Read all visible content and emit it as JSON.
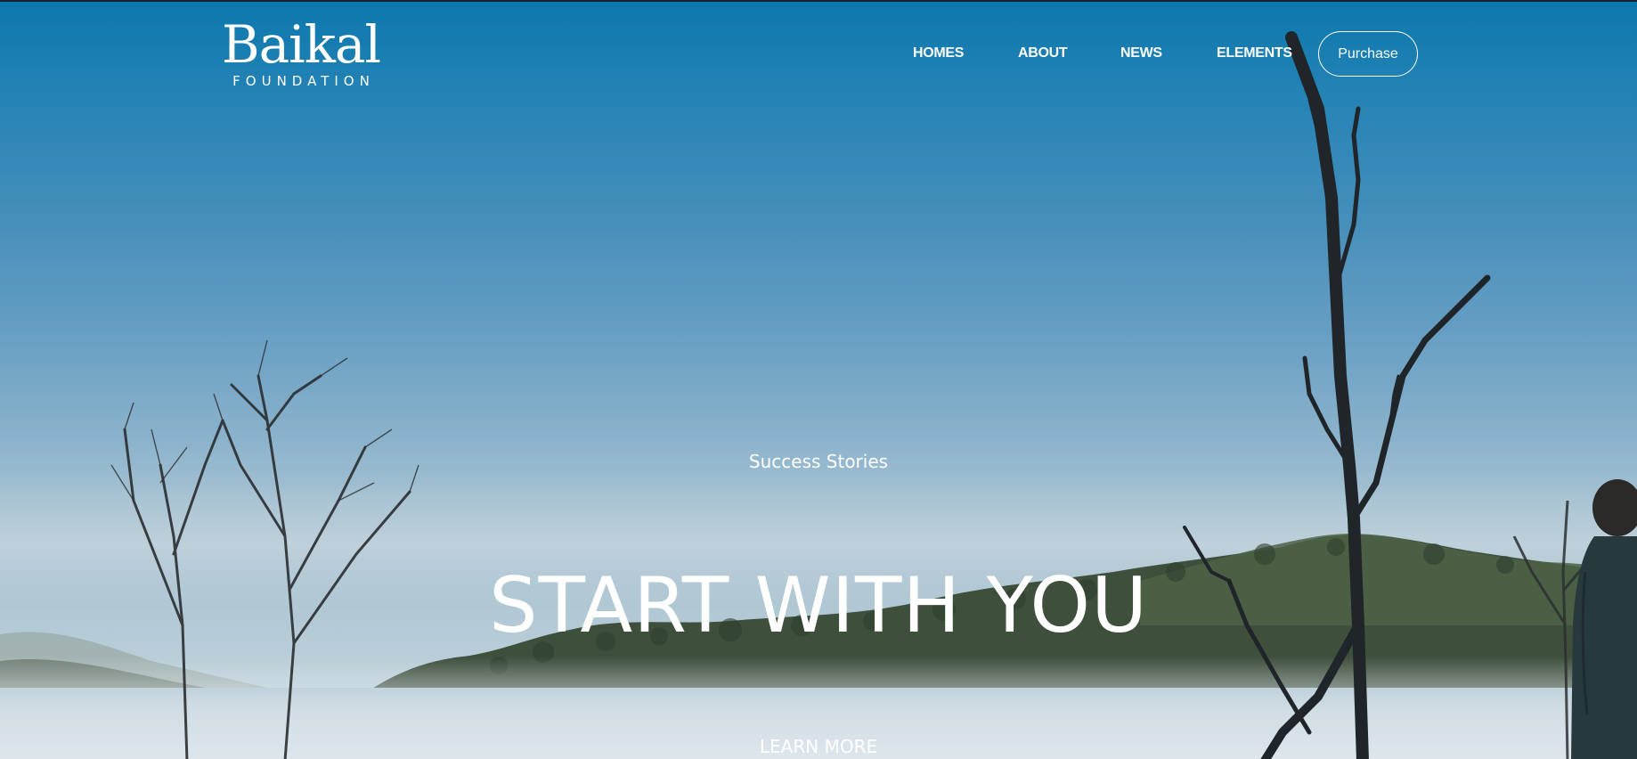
{
  "header": {
    "logo_main": "Baikal",
    "logo_sub": "FOUNDATION",
    "nav": [
      {
        "label": "HOMES"
      },
      {
        "label": "ABOUT"
      },
      {
        "label": "NEWS"
      },
      {
        "label": "ELEMENTS"
      }
    ],
    "purchase_label": "Purchase"
  },
  "hero": {
    "eyebrow": "Success Stories",
    "headline": "START WITH YOU",
    "cta_label": "LEARN MORE",
    "background": "misty-lake-landscape-photo"
  },
  "colors": {
    "sky_top": "#0c78ad",
    "sky_mid": "#6aa0c4",
    "mist": "#c9d8e0",
    "text": "#ffffff"
  }
}
